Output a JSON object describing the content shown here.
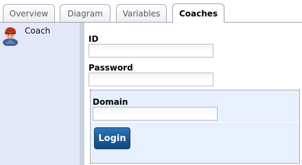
{
  "tabs": [
    {
      "label": "Overview",
      "active": false
    },
    {
      "label": "Diagram",
      "active": false
    },
    {
      "label": "Variables",
      "active": false
    },
    {
      "label": "Coaches",
      "active": true
    }
  ],
  "sidebar": {
    "items": [
      {
        "label": "Coach",
        "icon": "user-coach-icon"
      }
    ]
  },
  "form": {
    "id_label": "ID",
    "id_value": "",
    "password_label": "Password",
    "password_value": "",
    "domain_label": "Domain",
    "domain_value": "",
    "login_label": "Login"
  },
  "colors": {
    "sidebar_bg": "#e3e7f7",
    "domain_bg": "#e7f0fc",
    "login_button": "#1a5796"
  }
}
